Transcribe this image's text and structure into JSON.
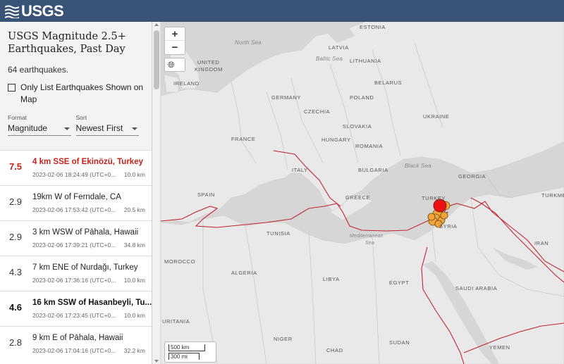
{
  "header": {
    "logo_text": "USGS"
  },
  "panel": {
    "title": "USGS Magnitude 2.5+ Earthquakes, Past Day",
    "count": "64 earthquakes.",
    "checkbox_label": "Only List Earthquakes Shown on Map",
    "format_label": "Format",
    "format_value": "Magnitude",
    "sort_label": "Sort",
    "sort_value": "Newest First"
  },
  "earthquakes": [
    {
      "mag": "7.5",
      "place": "4 km SSE of Ekinözü, Turkey",
      "time": "2023-02-06 18:24:49 (UTC+0...",
      "depth": "10.0 km"
    },
    {
      "mag": "2.9",
      "place": "19km W of Ferndale, CA",
      "time": "2023-02-06 17:53:42 (UTC+0...",
      "depth": "20.5 km"
    },
    {
      "mag": "2.9",
      "place": "3 km WSW of Pāhala, Hawaii",
      "time": "2023-02-06 17:39:21 (UTC+0...",
      "depth": "34.8 km"
    },
    {
      "mag": "4.3",
      "place": "7 km ENE of Nurdağı, Turkey",
      "time": "2023-02-06 17:36:16 (UTC+0...",
      "depth": "10.0 km"
    },
    {
      "mag": "4.6",
      "place": "16 km SSW of Hasanbeyli, Tu...",
      "time": "2023-02-06 17:23:45 (UTC+0...",
      "depth": "10.0 km"
    },
    {
      "mag": "2.8",
      "place": "9 km E of Pāhala, Hawaii",
      "time": "2023-02-06 17:04:16 (UTC+0...",
      "depth": "32.2 km"
    }
  ],
  "map": {
    "zoom_in": "+",
    "zoom_out": "−",
    "scale_km": "500 km",
    "scale_mi": "300 mi",
    "labels": {
      "estonia": "ESTONIA",
      "north_sea": "North Sea",
      "latvia": "LATVIA",
      "baltic_sea": "Baltic Sea",
      "united": "UNITED",
      "kingdom": "KINGDOM",
      "lithuania": "LITHUANIA",
      "ireland": "IRELAND",
      "belarus": "BELARUS",
      "germany": "GERMANY",
      "poland": "POLAND",
      "czechia": "CZECHIA",
      "ukraine": "UKRAINE",
      "slovakia": "SLOVAKIA",
      "france": "FRANCE",
      "hungary": "HUNGARY",
      "romania": "ROMANIA",
      "black_sea": "Black Sea",
      "georgia": "GEORGIA",
      "italy": "ITALY",
      "bulgaria": "BULGARIA",
      "spain": "SPAIN",
      "turkey": "TURKEY",
      "turkm": "TURKME",
      "greece": "GREECE",
      "syria": "SYRIA",
      "tunisia": "TUNISIA",
      "med1": "Mediterranean",
      "med2": "Sea",
      "iran": "IRAN",
      "morocco": "MOROCCO",
      "algeria": "ALGERIA",
      "libya": "LIBYA",
      "egypt": "EGYPT",
      "saudi": "SAUDI ARABIA",
      "uritania": "URITANIA",
      "niger": "NIGER",
      "chad": "CHAD",
      "sudan": "SUDAN",
      "yemen": "YEMEN"
    },
    "colors": {
      "major": "#ee1111",
      "recent": "#f2a43a"
    }
  }
}
